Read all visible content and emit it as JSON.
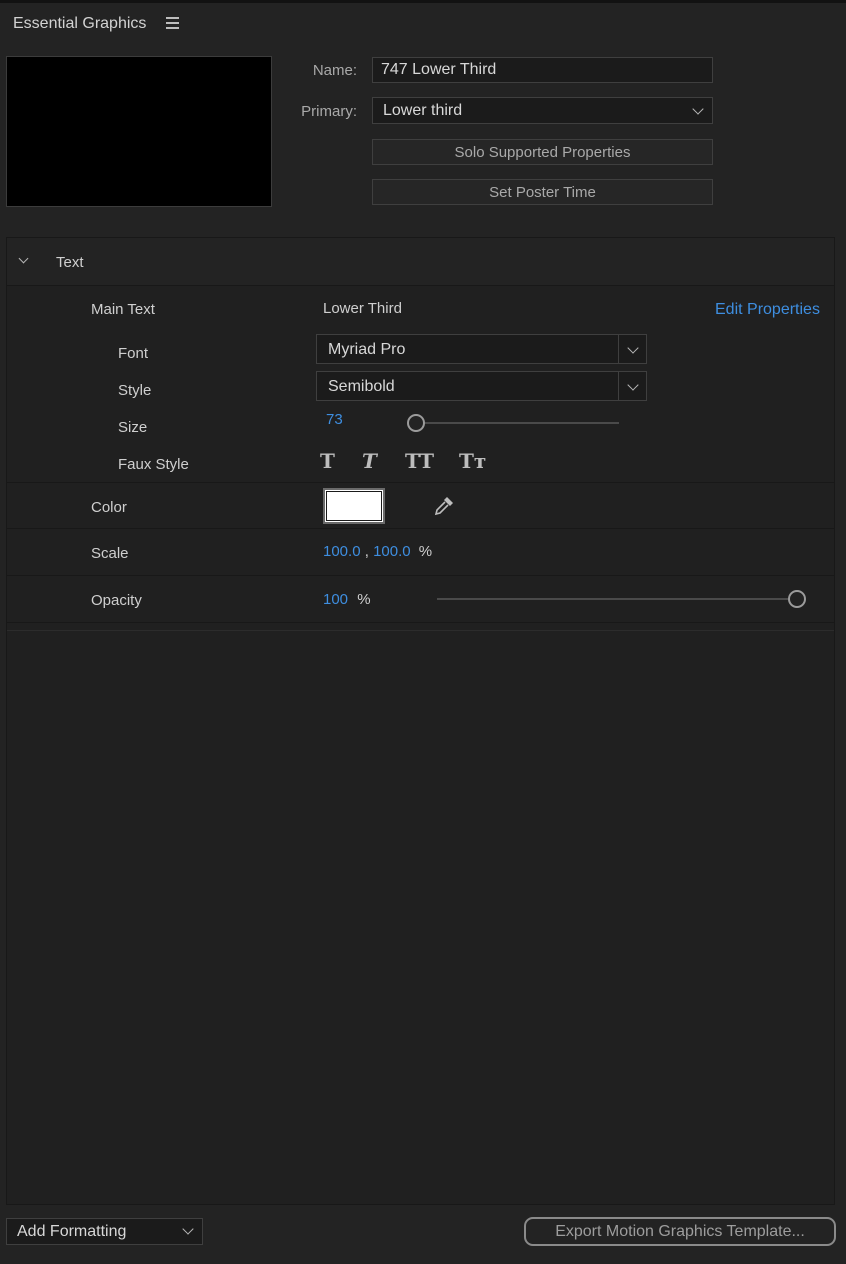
{
  "panel": {
    "title": "Essential Graphics"
  },
  "header": {
    "name_label": "Name:",
    "name_value": "747 Lower Third",
    "primary_label": "Primary:",
    "primary_value": "Lower third",
    "solo_button": "Solo Supported Properties",
    "poster_button": "Set Poster Time"
  },
  "section": {
    "title": "Text",
    "edit_properties": "Edit Properties",
    "main_text": {
      "label": "Main Text",
      "value": "Lower Third"
    },
    "font": {
      "label": "Font",
      "value": "Myriad Pro"
    },
    "style": {
      "label": "Style",
      "value": "Semibold"
    },
    "size": {
      "label": "Size",
      "value": "73",
      "slider_fraction": 0.0
    },
    "faux_style": {
      "label": "Faux Style",
      "buttons": [
        "T",
        "T",
        "TT",
        "Tт"
      ]
    },
    "color": {
      "label": "Color",
      "value": "#ffffff"
    },
    "scale": {
      "label": "Scale",
      "x": "100.0",
      "sep": ",",
      "y": "100.0",
      "unit": "%"
    },
    "opacity": {
      "label": "Opacity",
      "value": "100",
      "unit": "%",
      "slider_fraction": 1.0
    }
  },
  "footer": {
    "add_formatting": "Add Formatting",
    "export_button": "Export Motion Graphics Template..."
  },
  "colors": {
    "accent": "#3e8ee0",
    "background": "#232323"
  }
}
